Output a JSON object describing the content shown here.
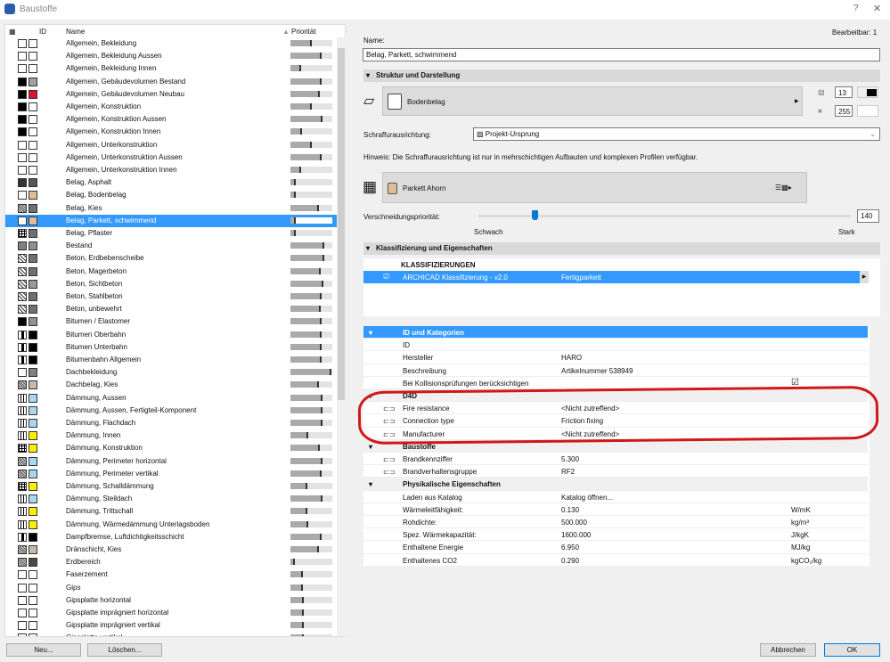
{
  "window": {
    "title": "Baustoffe",
    "help": "?",
    "close": "✕"
  },
  "list": {
    "headers": {
      "id": "ID",
      "name": "Name",
      "priority": "Priorität"
    },
    "items": [
      [
        "Allgemein, Bekleidung",
        "w",
        "#ffffff",
        0.5
      ],
      [
        "Allgemein, Bekleidung Aussen",
        "w",
        "#ffffff",
        0.75
      ],
      [
        "Allgemein, Bekleidung Innen",
        "w",
        "#ffffff",
        0.25
      ],
      [
        "Allgemein, Gebäudevolumen Bestand",
        "k",
        "#a0a0a0",
        0.75
      ],
      [
        "Allgemein, Gebäudevolumen Neubau",
        "k",
        "#e0102f",
        0.7
      ],
      [
        "Allgemein, Konstruktion",
        "k",
        "#ffffff",
        0.5
      ],
      [
        "Allgemein, Konstruktion Aussen",
        "k",
        "#ffffff",
        0.77
      ],
      [
        "Allgemein, Konstruktion Innen",
        "k",
        "#ffffff",
        0.27
      ],
      [
        "Allgemein, Unterkonstruktion",
        "w",
        "#ffffff",
        0.5
      ],
      [
        "Allgemein, Unterkonstruktion Aussen",
        "w",
        "#ffffff",
        0.75
      ],
      [
        "Allgemein, Unterkonstruktion Innen",
        "w",
        "#ffffff",
        0.25
      ],
      [
        "Belag, Asphalt",
        "#333333",
        "#555555",
        0.12
      ],
      [
        "Belag, Bodenbelag",
        "w",
        "#e0bc98",
        0.13
      ],
      [
        "Belag, Kies",
        "d",
        "#707070",
        0.68
      ],
      [
        "Belag, Parkett, schwimmend",
        "w",
        "#e0bc98",
        0.13
      ],
      [
        "Belag, Pflaster",
        "b",
        "#707070",
        0.13
      ],
      [
        "Bestand",
        "#808080",
        "#909090",
        0.8
      ],
      [
        "Beton, Erdbebenscheibe",
        "x",
        "#707070",
        0.8
      ],
      [
        "Beton, Magerbeton",
        "x",
        "#707070",
        0.73
      ],
      [
        "Beton, Sichtbeton",
        "x",
        "#a09890",
        0.78
      ],
      [
        "Beton, Stahlbeton",
        "x",
        "#707070",
        0.75
      ],
      [
        "Beton, unbewehrt",
        "x",
        "#707070",
        0.73
      ],
      [
        "Bitumen / Elastomer",
        "k",
        "#909090",
        0.75
      ],
      [
        "Bitumen Oberbahn",
        "s",
        "#000000",
        0.75
      ],
      [
        "Bitumen Unterbahn",
        "s",
        "#000000",
        0.75
      ],
      [
        "Bitumenbahn Allgemein",
        "s",
        "#000000",
        0.75
      ],
      [
        "Dachbekleidung",
        "w",
        "#808080",
        0.98
      ],
      [
        "Dachbelag, Kies",
        "d",
        "#d0b8a8",
        0.68
      ],
      [
        "Dämmung, Aussen",
        "v",
        "#a8d8f0",
        0.76
      ],
      [
        "Dämmung, Aussen, Fertigteil-Komponent",
        "v",
        "#a8d8f0",
        0.76
      ],
      [
        "Dämmung, Flachdach",
        "v",
        "#a8d8f0",
        0.76
      ],
      [
        "Dämmung, Innen",
        "v",
        "#ffee00",
        0.42
      ],
      [
        "Dämmung, Konstruktion",
        "b",
        "#ffee00",
        0.7
      ],
      [
        "Dämmung, Perimeter horizontal",
        "d",
        "#a8d8f0",
        0.77
      ],
      [
        "Dämmung, Perimeter vertikal",
        "d",
        "#a8d8f0",
        0.75
      ],
      [
        "Dämmung, Schalldämmung",
        "b",
        "#ffee00",
        0.4
      ],
      [
        "Dämmung, Steildach",
        "v",
        "#a8d8f0",
        0.77
      ],
      [
        "Dämmung, Trittschall",
        "v",
        "#ffee00",
        0.4
      ],
      [
        "Dämmung, Wärmedämmung Unterlagsboden",
        "v",
        "#ffee00",
        0.42
      ],
      [
        "Dampfbremse, Luftdichtigkeitsschicht",
        "s",
        "#000000",
        0.75
      ],
      [
        "Dränschicht, Kies",
        "d",
        "#c8b8a8",
        0.68
      ],
      [
        "Erdbereich",
        "d",
        "#504840",
        0.1
      ],
      [
        "Faserzement",
        "w",
        "#ffffff",
        0.3
      ],
      [
        "Gips",
        "w",
        "#ffffff",
        0.3
      ],
      [
        "Gipsplatte horizontal",
        "w",
        "#ffffff",
        0.32
      ],
      [
        "Gipsplatte imprägniert horizontal",
        "w",
        "#ffffff",
        0.32
      ],
      [
        "Gipsplatte imprägniert vertikal",
        "w",
        "#ffffff",
        0.32
      ],
      [
        "Gipsplatte vertikal",
        "w",
        "#ffffff",
        0.32
      ]
    ],
    "selected": 14,
    "new_btn": "Neu...",
    "delete_btn": "Löschen..."
  },
  "editor": {
    "editable": "Bearbeitbar: 1",
    "name_label": "Name:",
    "name_value": "Belag, Parkett, schwimmend",
    "sec_struct": "Struktur und Darstellung",
    "fill_name": "Bodenbelag",
    "pen1": "13",
    "pen2": "255",
    "hatch_label": "Schraffurausrichtung:",
    "hatch_value": "Projekt-Ursprung",
    "hint": "Hinweis: Die Schraffurausrichtung ist nur in mehrschichtigen Aufbauten und komplexen Profilen verfügbar.",
    "surface_name": "Parkett Ahorn",
    "surface_color": "#e0bc98",
    "prio_label": "Verschneidungspriorität:",
    "prio_value": "140",
    "prio_fraction": 0.15,
    "weak": "Schwach",
    "strong": "Stark",
    "sec_class": "Klassifizierung und Eigenschaften",
    "class_header": "KLASSIFIZIERUNGEN",
    "class_system": "ARCHICAD Klassifizierung - v2.0",
    "class_value": "Fertigparkett",
    "props": [
      {
        "t": "hl",
        "a": "ID und Kategorien"
      },
      {
        "a": "ID",
        "b": ""
      },
      {
        "a": "Hersteller",
        "b": "HARO"
      },
      {
        "a": "Beschreibung",
        "b": "Artikelnummer 538949"
      },
      {
        "a": "Bei Kollisionsprüfungen berücksichtigen",
        "b": "",
        "check": true
      },
      {
        "t": "grp",
        "a": "D4D"
      },
      {
        "a": "Fire resistance",
        "b": "<Nicht zutreffend>",
        "link": true
      },
      {
        "a": "Connection type",
        "b": "Friction fixing",
        "link": true
      },
      {
        "a": "Manufacturer",
        "b": "<Nicht zutreffend>",
        "link": true
      },
      {
        "t": "grp",
        "a": "Baustoffe"
      },
      {
        "a": "Brandkennziffer",
        "b": "5.300",
        "link": true
      },
      {
        "a": "Brandverhaltensgruppe",
        "b": "RF2",
        "link": true
      },
      {
        "t": "grp",
        "a": "Physikalische Eigenschaften"
      },
      {
        "a": "Laden aus Katalog",
        "b": "Katalog öffnen..."
      },
      {
        "a": "Wärmeleitfähigkeit:",
        "b": "0.130",
        "c": "W/mK"
      },
      {
        "a": "Rohdichte:",
        "b": "500.000",
        "c": "kg/m³"
      },
      {
        "a": "Spez. Wärmekapazität:",
        "b": "1600.000",
        "c": "J/kgK"
      },
      {
        "a": "Enthaltene Energie",
        "b": "6.950",
        "c": "MJ/kg"
      },
      {
        "a": "Enthaltenes CO2",
        "b": "0.290",
        "c": "kgCO₂/kg"
      }
    ],
    "cancel": "Abbrechen",
    "ok": "OK"
  }
}
